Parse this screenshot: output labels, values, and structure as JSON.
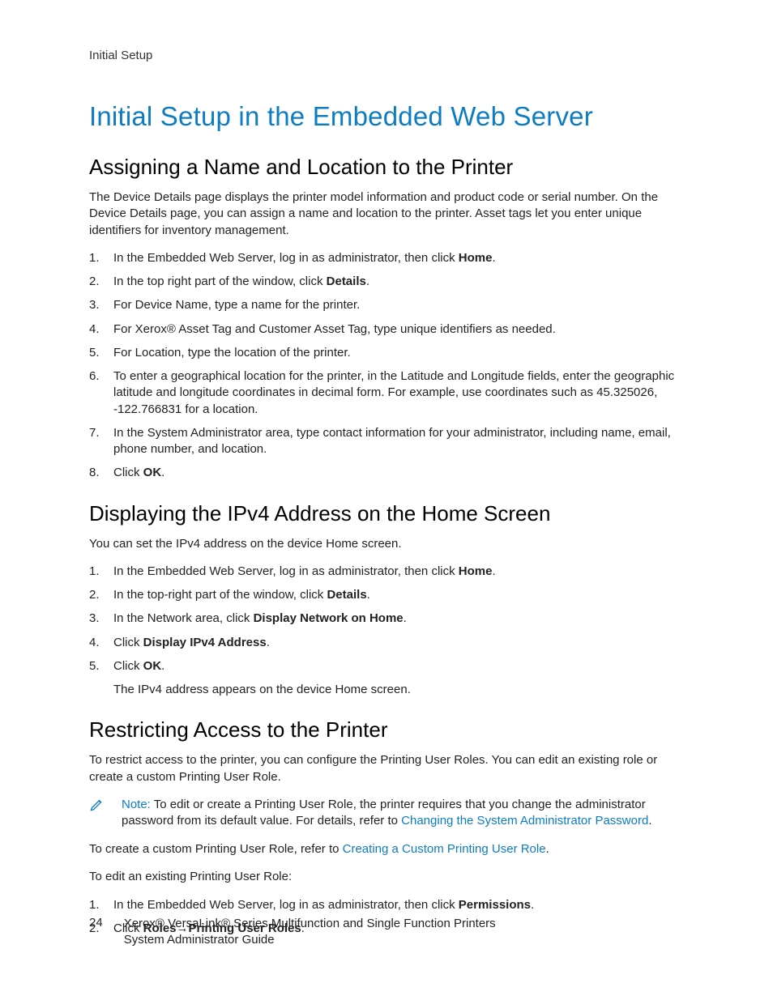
{
  "header": "Initial Setup",
  "title": "Initial Setup in the Embedded Web Server",
  "sec1": {
    "heading": "Assigning a Name and Location to the Printer",
    "intro": "The Device Details page displays the printer model information and product code or serial number. On the Device Details page, you can assign a name and location to the printer. Asset tags let you enter unique identifiers for inventory management.",
    "li1a": "In the Embedded Web Server, log in as administrator, then click ",
    "li1b": "Home",
    "li1c": ".",
    "li2a": "In the top right part of the window, click ",
    "li2b": "Details",
    "li2c": ".",
    "li3": "For Device Name, type a name for the printer.",
    "li4": "For Xerox® Asset Tag and Customer Asset Tag, type unique identifiers as needed.",
    "li5": "For Location, type the location of the printer.",
    "li6": "To enter a geographical location for the printer, in the Latitude and Longitude fields, enter the geographic latitude and longitude coordinates in decimal form. For example, use coordinates such as 45.325026, -122.766831 for a location.",
    "li7": "In the System Administrator area, type contact information for your administrator, including name, email, phone number, and location.",
    "li8a": "Click ",
    "li8b": "OK",
    "li8c": "."
  },
  "sec2": {
    "heading": "Displaying the IPv4 Address on the Home Screen",
    "intro": "You can set the IPv4 address on the device Home screen.",
    "li1a": "In the Embedded Web Server, log in as administrator, then click ",
    "li1b": "Home",
    "li1c": ".",
    "li2a": "In the top-right part of the window, click ",
    "li2b": "Details",
    "li2c": ".",
    "li3a": "In the Network area, click ",
    "li3b": "Display Network on Home",
    "li3c": ".",
    "li4a": "Click ",
    "li4b": "Display IPv4 Address",
    "li4c": ".",
    "li5a": "Click ",
    "li5b": "OK",
    "li5c": ".",
    "result": "The IPv4 address appears on the device Home screen."
  },
  "sec3": {
    "heading": "Restricting Access to the Printer",
    "intro": "To restrict access to the printer, you can configure the Printing User Roles. You can edit an existing role or create a custom Printing User Role.",
    "note_label": "Note:",
    "note_a": " To edit or create a Printing User Role, the printer requires that you change the administrator password from its default value. For details, refer to ",
    "note_link": "Changing the System Administrator Password",
    "note_c": ".",
    "para2a": "To create a custom Printing User Role, refer to ",
    "para2link": "Creating a Custom Printing User Role",
    "para2c": ".",
    "para3": "To edit an existing Printing User Role:",
    "li1a": "In the Embedded Web Server, log in as administrator, then click ",
    "li1b": "Permissions",
    "li1c": ".",
    "li2a": "Click ",
    "li2b": "Roles",
    "li2arrow": "→",
    "li2c": "Printing User Roles",
    "li2d": "."
  },
  "footer": {
    "page": "24",
    "line1": "Xerox® VersaLink® Series Multifunction and Single Function Printers",
    "line2": "System Administrator Guide"
  }
}
